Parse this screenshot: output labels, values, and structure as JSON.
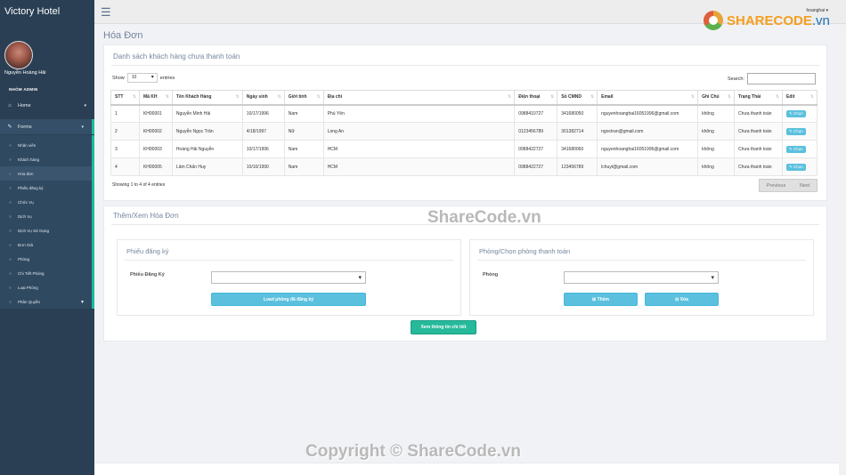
{
  "sidebar": {
    "brand": "Victory Hotel",
    "user_name": "Nguyễn Hoàng Hải",
    "role": "NHÓM ADMIN",
    "home_label": "Home",
    "forms_label": "Forms",
    "submenu": [
      "Nhân viên",
      "Khách hàng",
      "Hóa đơn",
      "Phiếu đăng ký",
      "Chức Vụ",
      "Dịch Vụ",
      "Dịch Vụ Sử Dụng",
      "Đơn Giá",
      "Phòng",
      "Chi Tiết Phòng",
      "Loại Phòng",
      "Phân Quyền"
    ],
    "active_item": "Hóa đơn"
  },
  "topbar": {
    "user": "hoanghai",
    "logo_share": "SHARE",
    "logo_code": "CODE",
    "logo_vn": ".vn"
  },
  "page": {
    "title": "Hóa Đơn"
  },
  "unpaid": {
    "title": "Danh sách khách hàng chưa thanh toán",
    "show_label": "Show",
    "entries_value": "10",
    "entries_label": "entries",
    "search_label": "Search:",
    "columns": [
      "STT",
      "Mã KH",
      "Tên Khách Hàng",
      "Ngày sinh",
      "Giới tính",
      "Địa chỉ",
      "Điện thoại",
      "Số CMND",
      "Email",
      "Ghi Chú",
      "Trạng Thái",
      "Edit"
    ],
    "rows": [
      {
        "stt": "1",
        "ma": "KH00001",
        "ten": "Nguyễn Minh Hải",
        "ngay": "10/17/1996",
        "gt": "Nam",
        "dc": "Phú Yên",
        "dt": "0988410727",
        "cmnd": "341680050",
        "email": "nguyenhoanghai16051996@gmail.com",
        "gc": "không",
        "tt": "Chưa thanh toán"
      },
      {
        "stt": "2",
        "ma": "KH00002",
        "ten": "Nguyễn Ngọc Trân",
        "ngay": "4/18/1997",
        "gt": "Nữ",
        "dc": "Long An",
        "dt": "0123456789",
        "cmnd": "301382714",
        "email": "ngoctran@gmail.com",
        "gc": "không",
        "tt": "Chưa thanh toán"
      },
      {
        "stt": "3",
        "ma": "KH00003",
        "ten": "Hoàng Hải Nguyễn",
        "ngay": "10/17/1996",
        "gt": "Nam",
        "dc": "HCM",
        "dt": "0988422727",
        "cmnd": "341680060",
        "email": "nguyenhoanghai16051996@gmail.com",
        "gc": "không",
        "tt": "Chưa thanh toán"
      },
      {
        "stt": "4",
        "ma": "KH00005",
        "ten": "Lâm Chấn Huy",
        "ngay": "10/10/1990",
        "gt": "Nam",
        "dc": "HCM",
        "dt": "0988422727",
        "cmnd": "123456789",
        "email": "lchuyt@gmail.com",
        "gc": "không",
        "tt": "Chưa thanh toán"
      }
    ],
    "edit_label": "Chọn",
    "info": "Showing 1 to 4 of 4 entries",
    "prev_label": "Previous",
    "next_label": "Next"
  },
  "invoice": {
    "title": "Thêm/Xem Hóa Đơn",
    "left_title": "Phiếu đăng ký",
    "left_field_label": "Phiếu Đăng Ký",
    "load_button": "Load phòng đã đăng ký",
    "right_title": "Phòng/Chọn phòng thanh toán",
    "right_field_label": "Phòng",
    "add_button": "⊞ Thêm",
    "delete_button": "⊟ Xóa",
    "view_button": "Xem thông tin chi tiết"
  },
  "watermark": {
    "center": "ShareCode.vn",
    "bottom": "Copyright © ShareCode.vn"
  }
}
